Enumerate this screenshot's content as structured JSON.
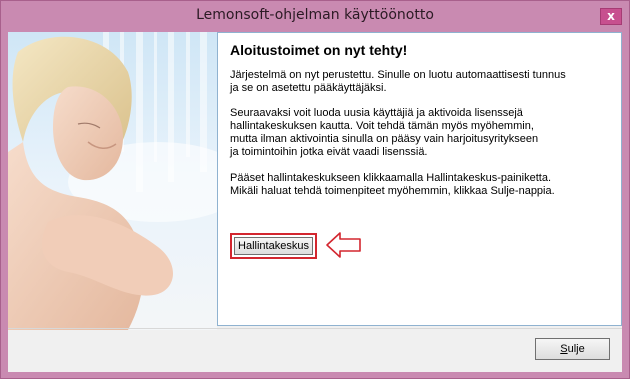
{
  "window": {
    "title": "Lemonsoft-ohjelman käyttöönotto",
    "close_glyph": "x"
  },
  "panel": {
    "heading": "Aloitustoimet on nyt tehty!",
    "paragraphs": [
      "Järjestelmä on nyt perustettu. Sinulle on luotu automaattisesti tunnus\nja se on asetettu pääkäyttäjäksi.",
      "Seuraavaksi voit luoda uusia käyttäjiä ja aktivoida lisenssejä\nhallintakeskuksen kautta. Voit tehdä tämän myös myöhemmin,\nmutta ilman aktivointia sinulla on pääsy vain harjoitusyritykseen\nja toimintoihin jotka eivät vaadi lisenssiä.",
      "Pääset hallintakeskukseen klikkaamalla Hallintakeskus-painiketta.\nMikäli haluat tehdä toimenpiteet myöhemmin, klikkaa Sulje-nappia."
    ],
    "hallintakeskus_label": "Hallintakeskus"
  },
  "footer": {
    "close_label_accel": "S",
    "close_label_rest": "ulje"
  },
  "colors": {
    "frame": "#c98ab1",
    "highlight_border": "#d3262f",
    "panel_border": "#8fb2d0"
  },
  "icons": {
    "arrow": "left-arrow-outline-icon",
    "photo": "woman-portrait-image"
  }
}
